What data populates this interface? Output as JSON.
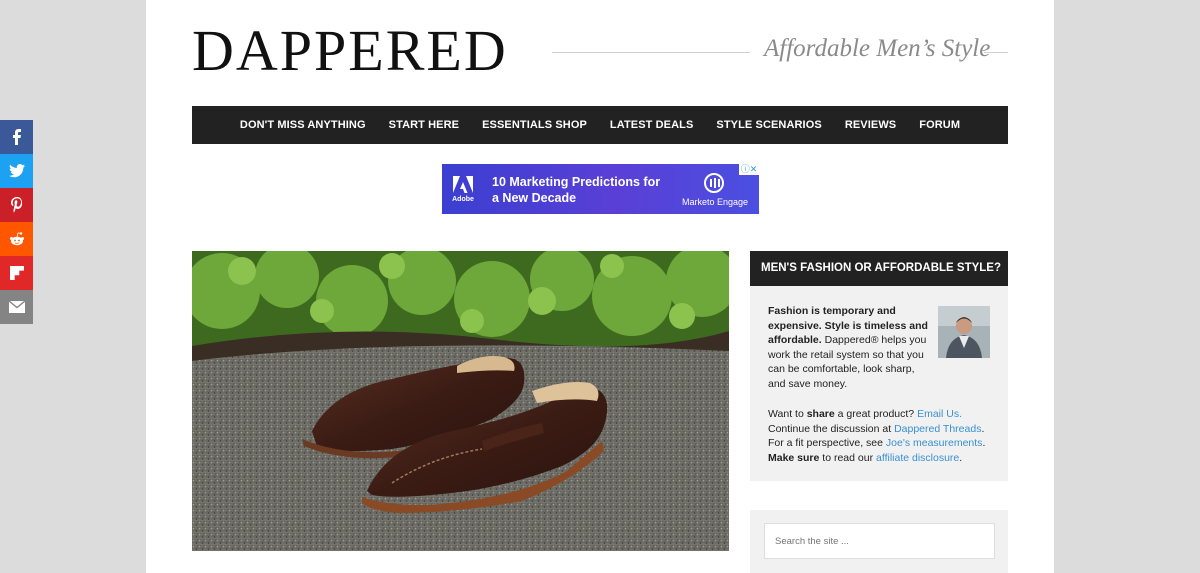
{
  "header": {
    "logo": "DAPPERED",
    "tagline": "Affordable Men’s Style"
  },
  "nav": {
    "items": [
      "DON'T MISS ANYTHING",
      "START HERE",
      "ESSENTIALS SHOP",
      "LATEST DEALS",
      "STYLE SCENARIOS",
      "REVIEWS",
      "FORUM"
    ]
  },
  "ad": {
    "brand": "Adobe",
    "headline": "10 Marketing Predictions for a New Decade",
    "sub": "Marketo Engage",
    "close": "ⓘ✕"
  },
  "hero": {
    "alt_icon": "penny-loafers-photo"
  },
  "sidebar": {
    "title": "MEN'S FASHION OR AFFORDABLE STYLE?",
    "intro_bold": "Fashion is temporary and expensive. Style is timeless and affordable.",
    "intro_rest": " Dappered® helps you work the retail system so that you can be comfortable, look sharp, and save money.",
    "line1_a": "Want to ",
    "line1_b": "share",
    "line1_c": " a great product? ",
    "line1_link": "Email Us.",
    "line2_a": "Continue the discussion at ",
    "line2_link": "Dappered Threads",
    "line2_c": ".",
    "line3_a": "For a fit perspective, see ",
    "line3_link": "Joe's measurements",
    "line3_c": ".",
    "line4_a": "Make sure",
    "line4_b": " to read our ",
    "line4_link": "affiliate disclosure",
    "line4_c": "."
  },
  "search": {
    "placeholder": "Search the site ..."
  },
  "share": {
    "colors": {
      "facebook": "#3b5998",
      "twitter": "#1da1f2",
      "pinterest": "#cb2027",
      "reddit": "#ff5700",
      "flipboard": "#e12828",
      "email": "#848484"
    }
  }
}
